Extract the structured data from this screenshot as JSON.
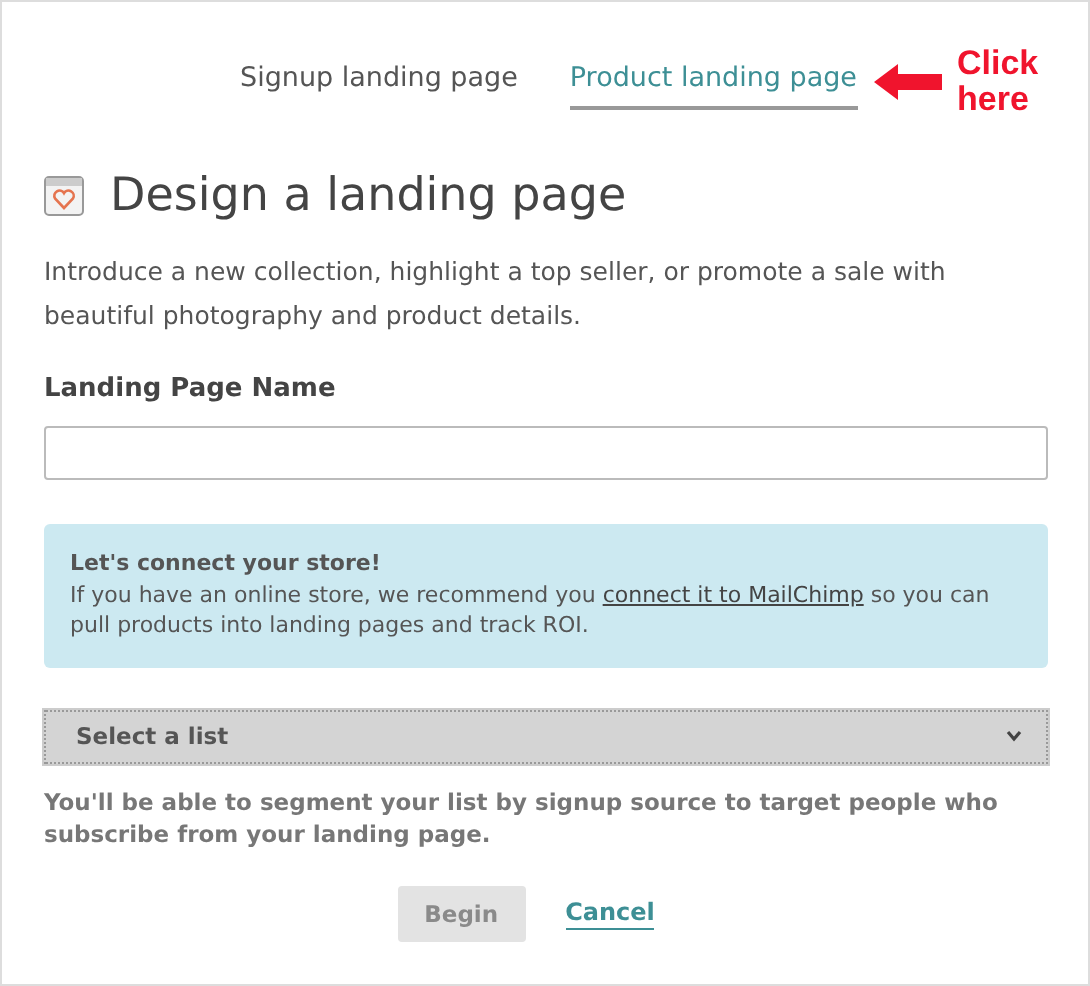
{
  "tabs": [
    {
      "label": "Signup landing page",
      "selected": false
    },
    {
      "label": "Product landing page",
      "selected": true
    }
  ],
  "annotation": {
    "text": "Click here"
  },
  "heading": "Design a landing page",
  "intro": "Introduce a new collection, highlight a top seller, or promote a sale with beautiful photography and product details.",
  "name_field": {
    "label": "Landing Page Name"
  },
  "notice": {
    "title": "Let's connect your store!",
    "text_before": "If you have an online store, we recommend you",
    "link": "connect it to MailChimp",
    "text_after": "so you can pull products into landing pages and track ROI."
  },
  "list_select": {
    "value": "Select a list"
  },
  "help": "You'll be able to segment your list by signup source to target people who subscribe from your landing page.",
  "buttons": [
    {
      "kind": "primary",
      "label": "Begin",
      "disabled": true
    },
    {
      "kind": "link",
      "label": "Cancel",
      "disabled": false
    }
  ]
}
